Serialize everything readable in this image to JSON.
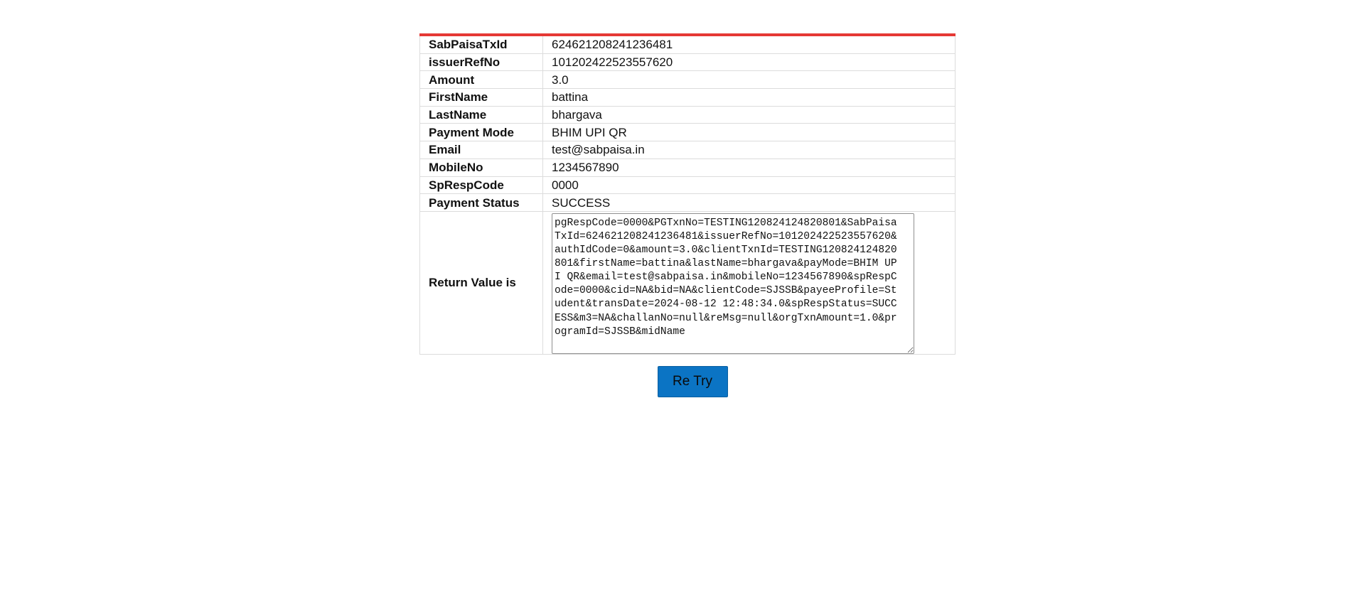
{
  "colors": {
    "accent_border": "#e53935",
    "button_bg": "#0b74c4"
  },
  "rows": [
    {
      "label": "SabPaisaTxId",
      "value": "624621208241236481"
    },
    {
      "label": "issuerRefNo",
      "value": "101202422523557620"
    },
    {
      "label": "Amount",
      "value": "3.0"
    },
    {
      "label": "FirstName",
      "value": "battina"
    },
    {
      "label": "LastName",
      "value": "bhargava"
    },
    {
      "label": "Payment Mode",
      "value": "BHIM UPI QR"
    },
    {
      "label": "Email",
      "value": "test@sabpaisa.in"
    },
    {
      "label": "MobileNo",
      "value": "1234567890"
    },
    {
      "label": "SpRespCode",
      "value": "0000"
    },
    {
      "label": "Payment Status",
      "value": "SUCCESS"
    }
  ],
  "return_value": {
    "label": "Return Value is",
    "text": "pgRespCode=0000&PGTxnNo=TESTING120824124820801&SabPaisaTxId=624621208241236481&issuerRefNo=101202422523557620&authIdCode=0&amount=3.0&clientTxnId=TESTING120824124820801&firstName=battina&lastName=bhargava&payMode=BHIM UPI QR&email=test@sabpaisa.in&mobileNo=1234567890&spRespCode=0000&cid=NA&bid=NA&clientCode=SJSSB&payeeProfile=Student&transDate=2024-08-12 12:48:34.0&spRespStatus=SUCCESS&m3=NA&challanNo=null&reMsg=null&orgTxnAmount=1.0&programId=SJSSB&midName"
  },
  "retry_button": {
    "label": "Re Try"
  }
}
